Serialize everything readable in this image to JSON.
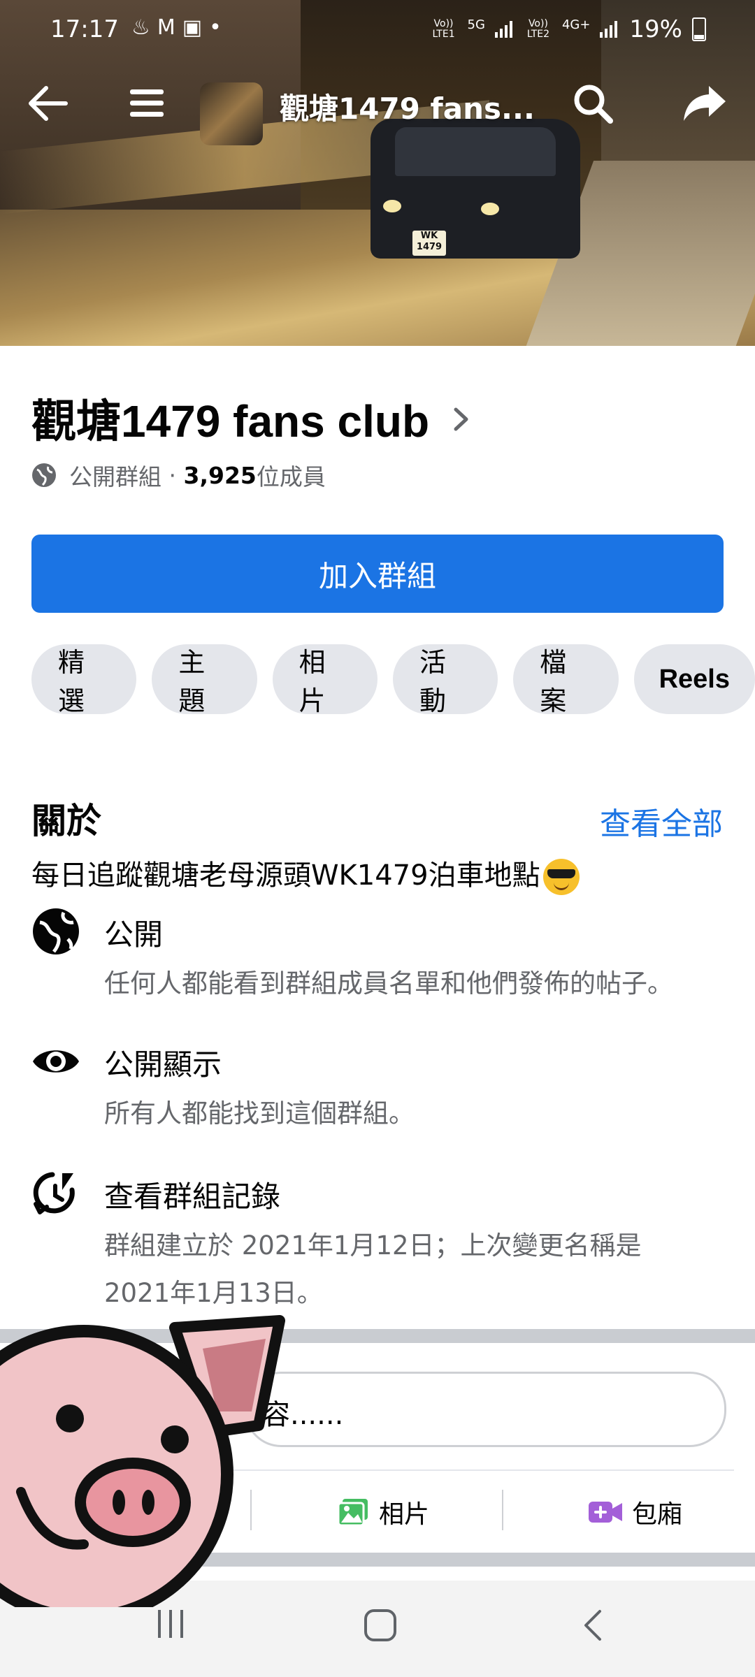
{
  "status_bar": {
    "time": "17:17",
    "left_icons": [
      "notification-icon",
      "gmail-icon",
      "app-icon",
      "dot-icon"
    ],
    "sim1_label": "Vo)) LTE1",
    "network_5g": "5G",
    "sim2_label": "Vo)) LTE2",
    "network_4g": "4G+",
    "battery": "19%"
  },
  "header": {
    "title": "觀塘1479 fans...",
    "icons": [
      "back-icon",
      "menu-icon",
      "search-icon",
      "share-icon"
    ]
  },
  "cover": {
    "plate": "WK 1479"
  },
  "group": {
    "name": "觀塘1479 fans club",
    "privacy": "公開群組",
    "separator": " · ",
    "member_count": "3,925",
    "member_suffix": "位成員"
  },
  "join_button": {
    "label": "加入群組",
    "color": "#1b74e4"
  },
  "tabs": [
    "精選",
    "主題",
    "相片",
    "活動",
    "檔案",
    "Reels"
  ],
  "about": {
    "title": "關於",
    "see_all": "查看全部",
    "description": "每日追蹤觀塘老母源頭WK1479泊車地點",
    "items": [
      {
        "icon": "globe-icon",
        "title": "公開",
        "subtitle": "任何人都能看到群組成員名單和他們發佈的帖子。"
      },
      {
        "icon": "eye-icon",
        "title": "公開顯示",
        "subtitle": "所有人都能找到這個群組。"
      },
      {
        "icon": "history-icon",
        "title": "查看群組記錄",
        "subtitle_line1": "群組建立於 2021年1月12日；上次變更名稱是",
        "subtitle_line2": "2021年1月13日。"
      }
    ]
  },
  "composer": {
    "placeholder_visible": "容......",
    "actions": [
      {
        "icon": "photo-icon",
        "label": "相片",
        "color": "#45bd62"
      },
      {
        "icon": "room-icon",
        "label": "包廂",
        "color": "#a35fd8"
      }
    ]
  },
  "system_nav": [
    "recent-apps-icon",
    "home-icon",
    "back-nav-icon"
  ],
  "colors": {
    "accent": "#1b74e4",
    "secondary_text": "#65676b",
    "chip_bg": "#e4e6eb"
  }
}
